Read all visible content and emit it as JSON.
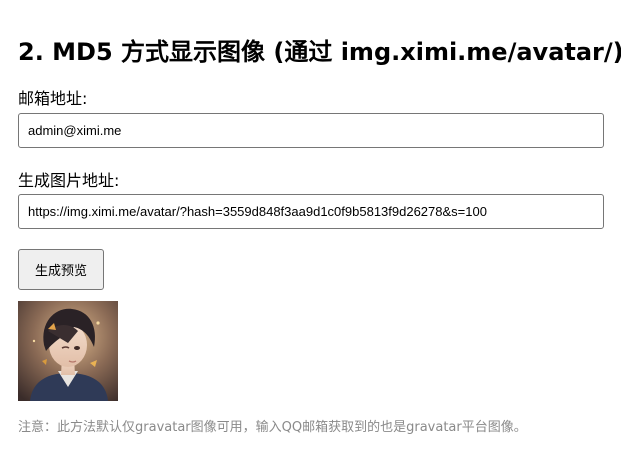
{
  "heading": "2. MD5 方式显示图像 (通过 img.ximi.me/avatar/)",
  "email": {
    "label": "邮箱地址:",
    "value": "admin@ximi.me"
  },
  "url": {
    "label": "生成图片地址:",
    "value": "https://img.ximi.me/avatar/?hash=3559d848f3aa9d1c0f9b5813f9d26278&s=100"
  },
  "generate_button": "生成预览",
  "note": "注意：此方法默认仅gravatar图像可用，输入QQ邮箱获取到的也是gravatar平台图像。"
}
